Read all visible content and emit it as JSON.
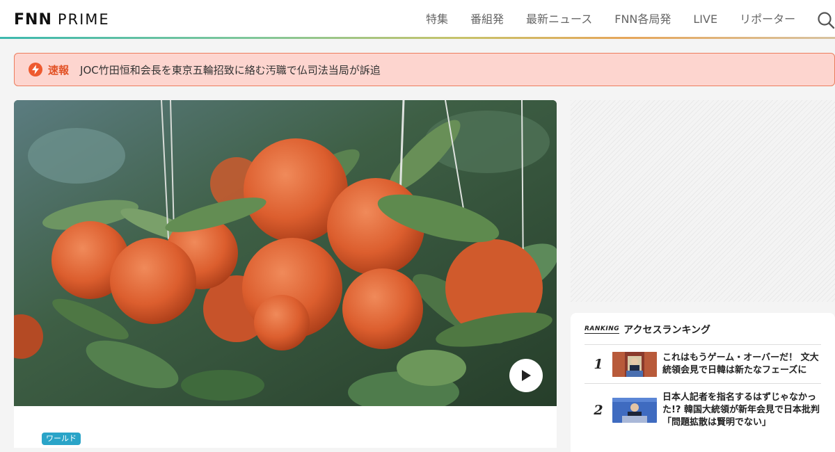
{
  "header": {
    "logo_bold": "FNN",
    "logo_light": "PRIME",
    "nav": [
      "特集",
      "番組発",
      "最新ニュース",
      "FNN各局発",
      "LIVE",
      "リポーター"
    ]
  },
  "breaking": {
    "label": "速報",
    "text": "JOC竹田恒和会長を東京五輪招致に絡む汚職で仏司法当局が訴追"
  },
  "hero": {
    "category": "ワールド"
  },
  "ranking": {
    "badge": "RANKING",
    "title": "アクセスランキング",
    "items": [
      {
        "rank": "1",
        "title": "これはもうゲーム・オーバーだ！ 文大統領会見で日韓は新たなフェーズに"
      },
      {
        "rank": "2",
        "title": "日本人記者を指名するはずじゃなかった!? 韓国大統領が新年会見で日本批判「問題拡散は賢明でない」"
      }
    ]
  },
  "colors": {
    "accent_red": "#ee5a2f",
    "breaking_bg": "#fdd5cf",
    "tag_blue": "#2aa4c8"
  }
}
